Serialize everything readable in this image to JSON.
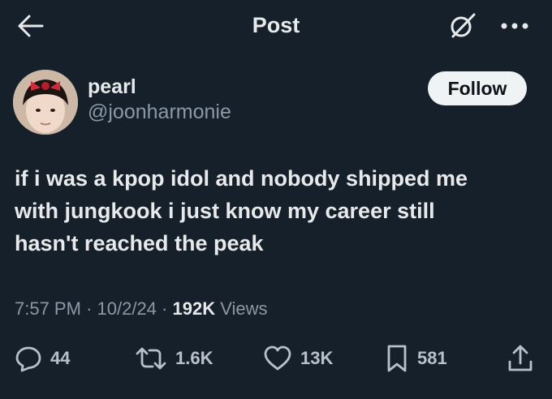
{
  "header": {
    "title": "Post",
    "back_icon": "arrow-left-icon",
    "grok_icon": "grok-icon",
    "more_icon": "more-horizontal-icon"
  },
  "author": {
    "display_name": "pearl",
    "handle": "@joonharmonie",
    "follow_label": "Follow"
  },
  "post": {
    "line1": "if i was a kpop idol and nobody shipped me",
    "line2": "with jungkook i just know my career still",
    "line3": "hasn't reached the peak"
  },
  "meta": {
    "time": "7:57 PM",
    "sep1": "·",
    "date": "10/2/24",
    "sep2": "·",
    "views_count": "192K",
    "views_label": "Views"
  },
  "actions": {
    "replies": "44",
    "reposts": "1.6K",
    "likes": "13K",
    "bookmarks": "581"
  },
  "colors": {
    "background": "#15202b",
    "text": "#e7e9ea",
    "muted": "#8b98a5",
    "follow_bg": "#eff3f4"
  }
}
